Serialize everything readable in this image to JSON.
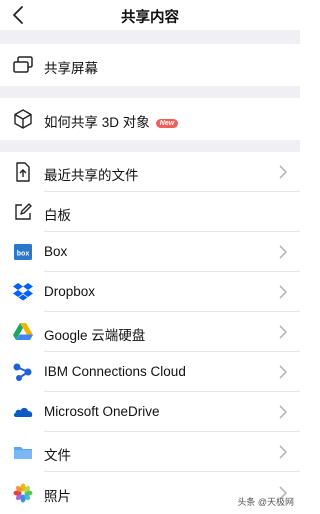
{
  "header": {
    "title": "共享内容"
  },
  "section1": {
    "share_screen_label": "共享屏幕"
  },
  "section2": {
    "share_3d_label": "如何共享 3D 对象",
    "new_badge": "New"
  },
  "list": {
    "items": [
      {
        "label": "最近共享的文件",
        "icon": "recent-file-icon",
        "chevron": true
      },
      {
        "label": "白板",
        "icon": "whiteboard-icon",
        "chevron": false
      },
      {
        "label": "Box",
        "icon": "box-icon",
        "chevron": true
      },
      {
        "label": "Dropbox",
        "icon": "dropbox-icon",
        "chevron": true
      },
      {
        "label": "Google 云端硬盘",
        "icon": "google-drive-icon",
        "chevron": true
      },
      {
        "label": "IBM Connections Cloud",
        "icon": "ibm-connections-icon",
        "chevron": true
      },
      {
        "label": "Microsoft OneDrive",
        "icon": "onedrive-icon",
        "chevron": true
      },
      {
        "label": "文件",
        "icon": "files-folder-icon",
        "chevron": true
      },
      {
        "label": "照片",
        "icon": "photos-icon",
        "chevron": true
      }
    ]
  },
  "watermark": "头条 @天极网",
  "colors": {
    "background_gap": "#efeff4",
    "badge": "#f0605a",
    "box": "#2b77c9",
    "dropbox": "#0061fe",
    "ibm": "#1f62d6",
    "onedrive": "#0a5bc4",
    "folder": "#59a6f2"
  }
}
